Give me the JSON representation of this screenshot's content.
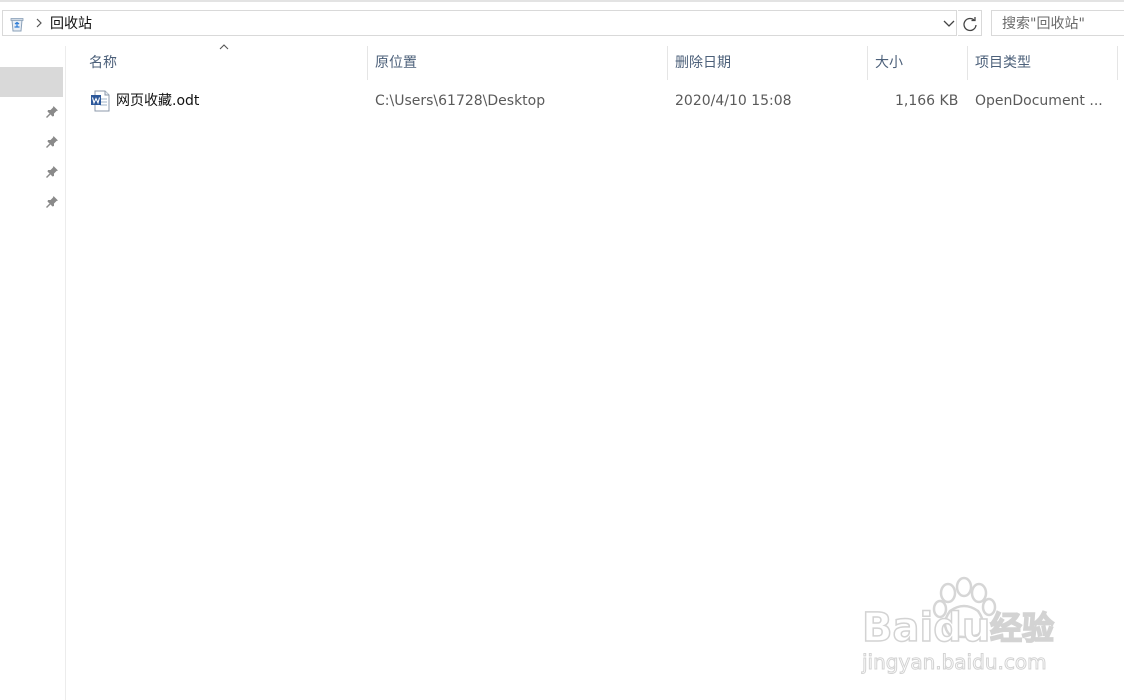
{
  "address_bar": {
    "location_icon": "recycle-bin-icon",
    "separator_icon": "chevron-right-icon",
    "path": "回收站",
    "dropdown_icon": "chevron-down-icon",
    "refresh_icon": "refresh-icon"
  },
  "search": {
    "placeholder": "搜索\"回收站\""
  },
  "navigation": {
    "pin_icon": "pin-icon",
    "pin_count": 4
  },
  "columns": {
    "name": "名称",
    "original_location": "原位置",
    "date_deleted": "删除日期",
    "size": "大小",
    "item_type": "项目类型",
    "sort_icon": "sort-ascending-caret-icon"
  },
  "files": [
    {
      "icon": "word-document-icon",
      "name": "网页收藏.odt",
      "original_location": "C:\\Users\\61728\\Desktop",
      "date_deleted": "2020/4/10 15:08",
      "size": "1,166 KB",
      "item_type": "OpenDocument ..."
    }
  ],
  "watermark": {
    "brand_text": "Baidu",
    "cn_text": "经验",
    "url_text": "jingyan.baidu.com",
    "paw_icon": "baidu-paw-icon"
  },
  "colors": {
    "header_text": "#4c607a",
    "selection_bg": "#d9d9d9",
    "border": "#d9d9d9",
    "watermark": "#d6d6d6"
  }
}
